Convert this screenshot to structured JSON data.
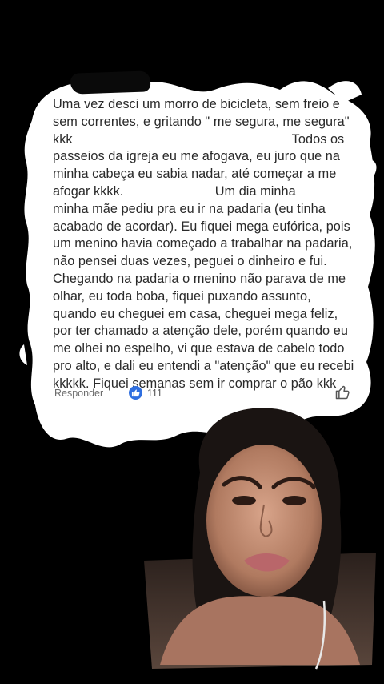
{
  "comment": {
    "lines": [
      "Uma vez desci um morro de bicicleta, sem freio e",
      "sem correntes, e gritando \" me segura, me segura\"",
      "kkk                                                            Todos os",
      "passeios da igreja eu me afogava, eu juro que na",
      "minha cabeça eu sabia nadar, até começar a me",
      "afogar kkkk.                         Um dia minha",
      "minha mãe pediu pra eu ir na padaria (eu tinha",
      "acabado de acordar). Eu fiquei mega eufórica, pois",
      "um menino havia começado a trabalhar na padaria,",
      "não pensei duas vezes, peguei o dinheiro e fui.",
      "Chegando na padaria o menino não parava de me",
      "olhar, eu toda boba, fiquei puxando assunto,",
      "quando eu cheguei em casa, cheguei mega feliz,",
      "por ter chamado a atenção dele, porém quando eu",
      "me olhei no espelho, vi que estava de cabelo todo",
      "pro alto, e dali eu entendi a \"atenção\" que eu recebi",
      "kkkkk. Fiquei semanas sem ir comprar o pão kkk"
    ]
  },
  "footer": {
    "reply_label": "Responder",
    "like_count": "111"
  },
  "colors": {
    "background": "#000000",
    "card": "#ffffff",
    "text": "#2a2a2a",
    "like_blue": "#2f6fe0"
  },
  "icons": [
    "thumbs-up-filled-icon",
    "thumbs-up-outline-icon"
  ]
}
